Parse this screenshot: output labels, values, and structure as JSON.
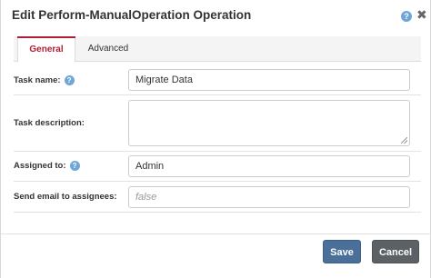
{
  "dialog": {
    "title": "Edit Perform-ManualOperation Operation",
    "help_icon": "?",
    "close_icon": "✖"
  },
  "tabs": [
    {
      "label": "General",
      "active": true
    },
    {
      "label": "Advanced",
      "active": false
    }
  ],
  "form": {
    "task_name": {
      "label": "Task name:",
      "value": "Migrate Data",
      "help": "?"
    },
    "task_description": {
      "label": "Task description:",
      "value": ""
    },
    "assigned_to": {
      "label": "Assigned to:",
      "value": "Admin",
      "help": "?"
    },
    "send_email": {
      "label": "Send email to assignees:",
      "placeholder": "false"
    }
  },
  "buttons": {
    "save": "Save",
    "cancel": "Cancel"
  },
  "colors": {
    "accent_tab": "#b02034",
    "save_button": "#4a6f98",
    "cancel_button": "#5b6165",
    "help_icon": "#6ea6d8"
  }
}
